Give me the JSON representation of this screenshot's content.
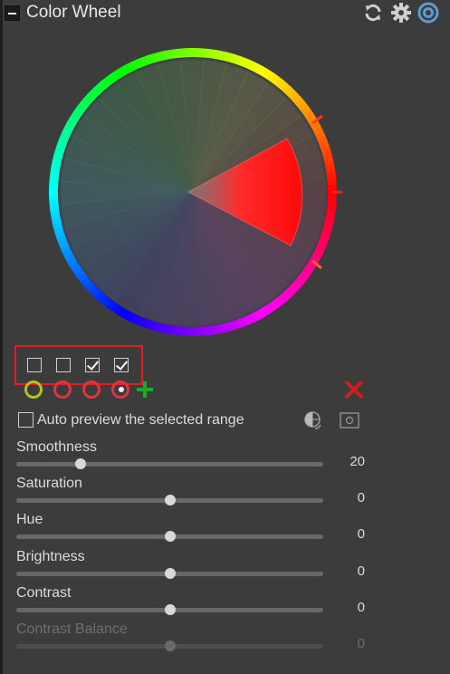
{
  "panel": {
    "title": "Color Wheel",
    "header_icons": [
      "refresh-icon",
      "gear-icon",
      "target-icon"
    ]
  },
  "wheel": {
    "selected_hue": "red",
    "accent": "#ff1a1a"
  },
  "range_checkboxes": [
    {
      "checked": false
    },
    {
      "checked": false
    },
    {
      "checked": true
    },
    {
      "checked": true
    }
  ],
  "range_markers": [
    {
      "color": "#b7c21d",
      "icon": "range-marker-icon"
    },
    {
      "color": "#e0353d",
      "icon": "range-marker-icon"
    },
    {
      "color": "#e0353d",
      "icon": "range-marker-icon"
    },
    {
      "color": "#e0353d",
      "icon": "range-marker-icon"
    }
  ],
  "auto_preview": {
    "label": "Auto preview the selected range",
    "checked": false
  },
  "sliders": [
    {
      "label": "Smoothness",
      "value": "20",
      "level": 0.21,
      "enabled": true
    },
    {
      "label": "Saturation",
      "value": "0",
      "level": 0.5,
      "enabled": true
    },
    {
      "label": "Hue",
      "value": "0",
      "level": 0.5,
      "enabled": true
    },
    {
      "label": "Brightness",
      "value": "0",
      "level": 0.5,
      "enabled": true
    },
    {
      "label": "Contrast",
      "value": "0",
      "level": 0.5,
      "enabled": true
    },
    {
      "label": "Contrast Balance",
      "value": "0",
      "level": 0.5,
      "enabled": false
    }
  ]
}
